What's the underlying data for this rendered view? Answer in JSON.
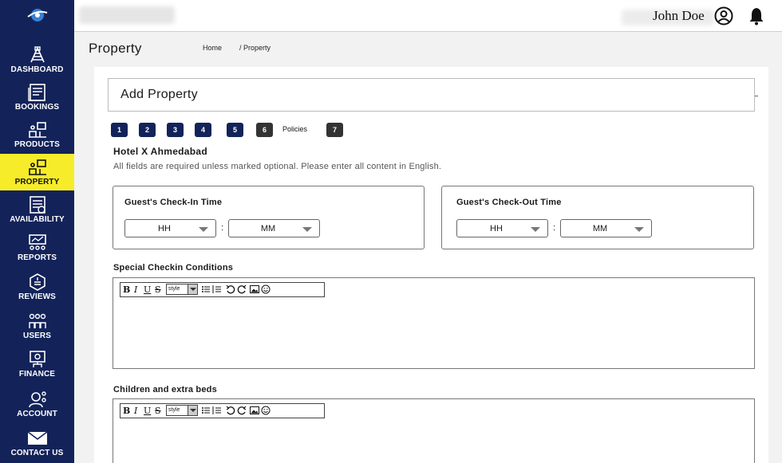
{
  "user": {
    "name": "John Doe"
  },
  "sidebar": {
    "items": [
      {
        "label": "DASHBOARD",
        "icon": "dashboard-icon"
      },
      {
        "label": "BOOKINGS",
        "icon": "bookings-icon"
      },
      {
        "label": "PRODUCTS",
        "icon": "products-icon"
      },
      {
        "label": "PROPERTY",
        "icon": "property-icon",
        "active": true
      },
      {
        "label": "AVAILABILITY",
        "icon": "availability-icon"
      },
      {
        "label": "REPORTS",
        "icon": "reports-icon"
      },
      {
        "label": "REVIEWS",
        "icon": "reviews-icon"
      },
      {
        "label": "USERS",
        "icon": "users-icon"
      },
      {
        "label": "FINANCE",
        "icon": "finance-icon"
      },
      {
        "label": "ACCOUNT",
        "icon": "account-icon"
      },
      {
        "label": "CONTACT US",
        "icon": "mail-icon"
      }
    ]
  },
  "header": {
    "title": "Property",
    "breadcrumb": [
      "Home",
      "/ Property"
    ]
  },
  "form": {
    "title": "Add Property",
    "steps": [
      {
        "label": "1"
      },
      {
        "label": "2"
      },
      {
        "label": "3"
      },
      {
        "label": "4"
      },
      {
        "label": "5"
      },
      {
        "label": "6"
      },
      {
        "label": "7"
      }
    ],
    "current_step_label": "Policies",
    "hotel_name": "Hotel X Ahmedabad",
    "note": "All fields are required unless marked optional. Please enter all content in English.",
    "checkin": {
      "title": "Guest's Check-In Time",
      "hh": "HH",
      "mm": "MM"
    },
    "checkout": {
      "title": "Guest's Check-Out Time",
      "hh": "HH",
      "mm": "MM"
    },
    "separator": ":",
    "special_conditions_label": "Special Checkin Conditions",
    "children_label": "Children and extra beds"
  },
  "editor_toolbar": {
    "bold": "B",
    "italic": "I",
    "underline": "U",
    "strike": "S",
    "style": "style"
  },
  "colors": {
    "sidebar": "#13235a",
    "active": "#f7ec2a",
    "step": "#13235a",
    "step_dark": "#333333"
  }
}
